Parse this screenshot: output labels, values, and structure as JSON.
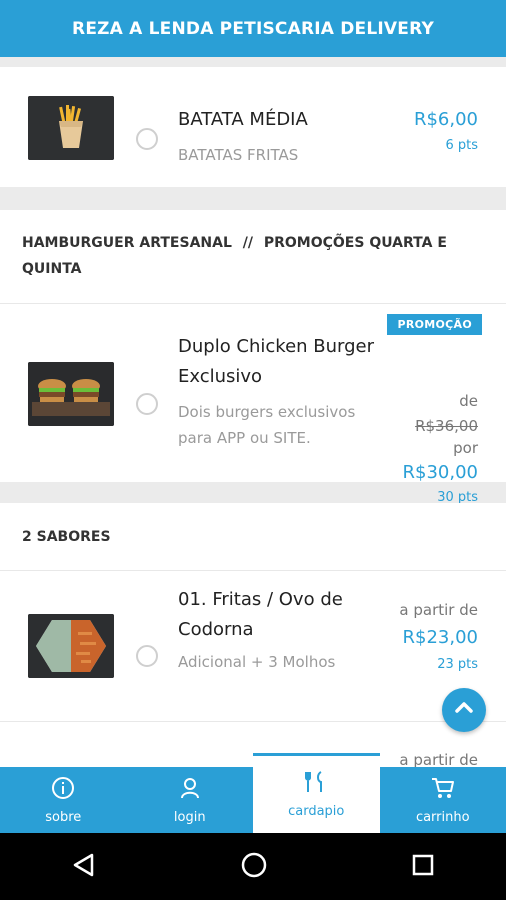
{
  "header": {
    "title": "REZA A LENDA PETISCARIA DELIVERY"
  },
  "items": {
    "batata": {
      "title": "BATATA MÉDIA",
      "subtitle": "BATATAS FRITAS",
      "price": "R$6,00",
      "pts": "6 pts"
    },
    "burger": {
      "badge": "PROMOÇÃO",
      "title_line1": "Duplo Chicken Burger",
      "title_line2": "Exclusivo",
      "desc_line1": "Dois burgers exclusivos",
      "desc_line2": "para APP ou SITE.",
      "de": "de",
      "old_price": "R$36,00",
      "por": "por",
      "price": "R$30,00",
      "pts": "30 pts"
    },
    "fritas": {
      "title_line1": "01. Fritas / Ovo de",
      "title_line2": "Codorna",
      "subtitle": "Adicional + 3 Molhos",
      "from": "a partir de",
      "price": "R$23,00",
      "pts": "23 pts"
    },
    "next": {
      "from": "a partir de"
    }
  },
  "sections": {
    "hamburguer": {
      "name": "HAMBURGUER ARTESANAL",
      "sep": "//",
      "promo_line1": "PROMOÇÕES QUARTA E",
      "promo_line2": "QUINTA"
    },
    "sabores": {
      "name": "2 SABORES"
    }
  },
  "tabs": [
    {
      "label": "sobre",
      "icon": "info-icon"
    },
    {
      "label": "login",
      "icon": "user-icon"
    },
    {
      "label": "cardapio",
      "icon": "cutlery-icon",
      "active": true
    },
    {
      "label": "carrinho",
      "icon": "cart-icon"
    }
  ],
  "colors": {
    "accent": "#2a9fd6"
  }
}
